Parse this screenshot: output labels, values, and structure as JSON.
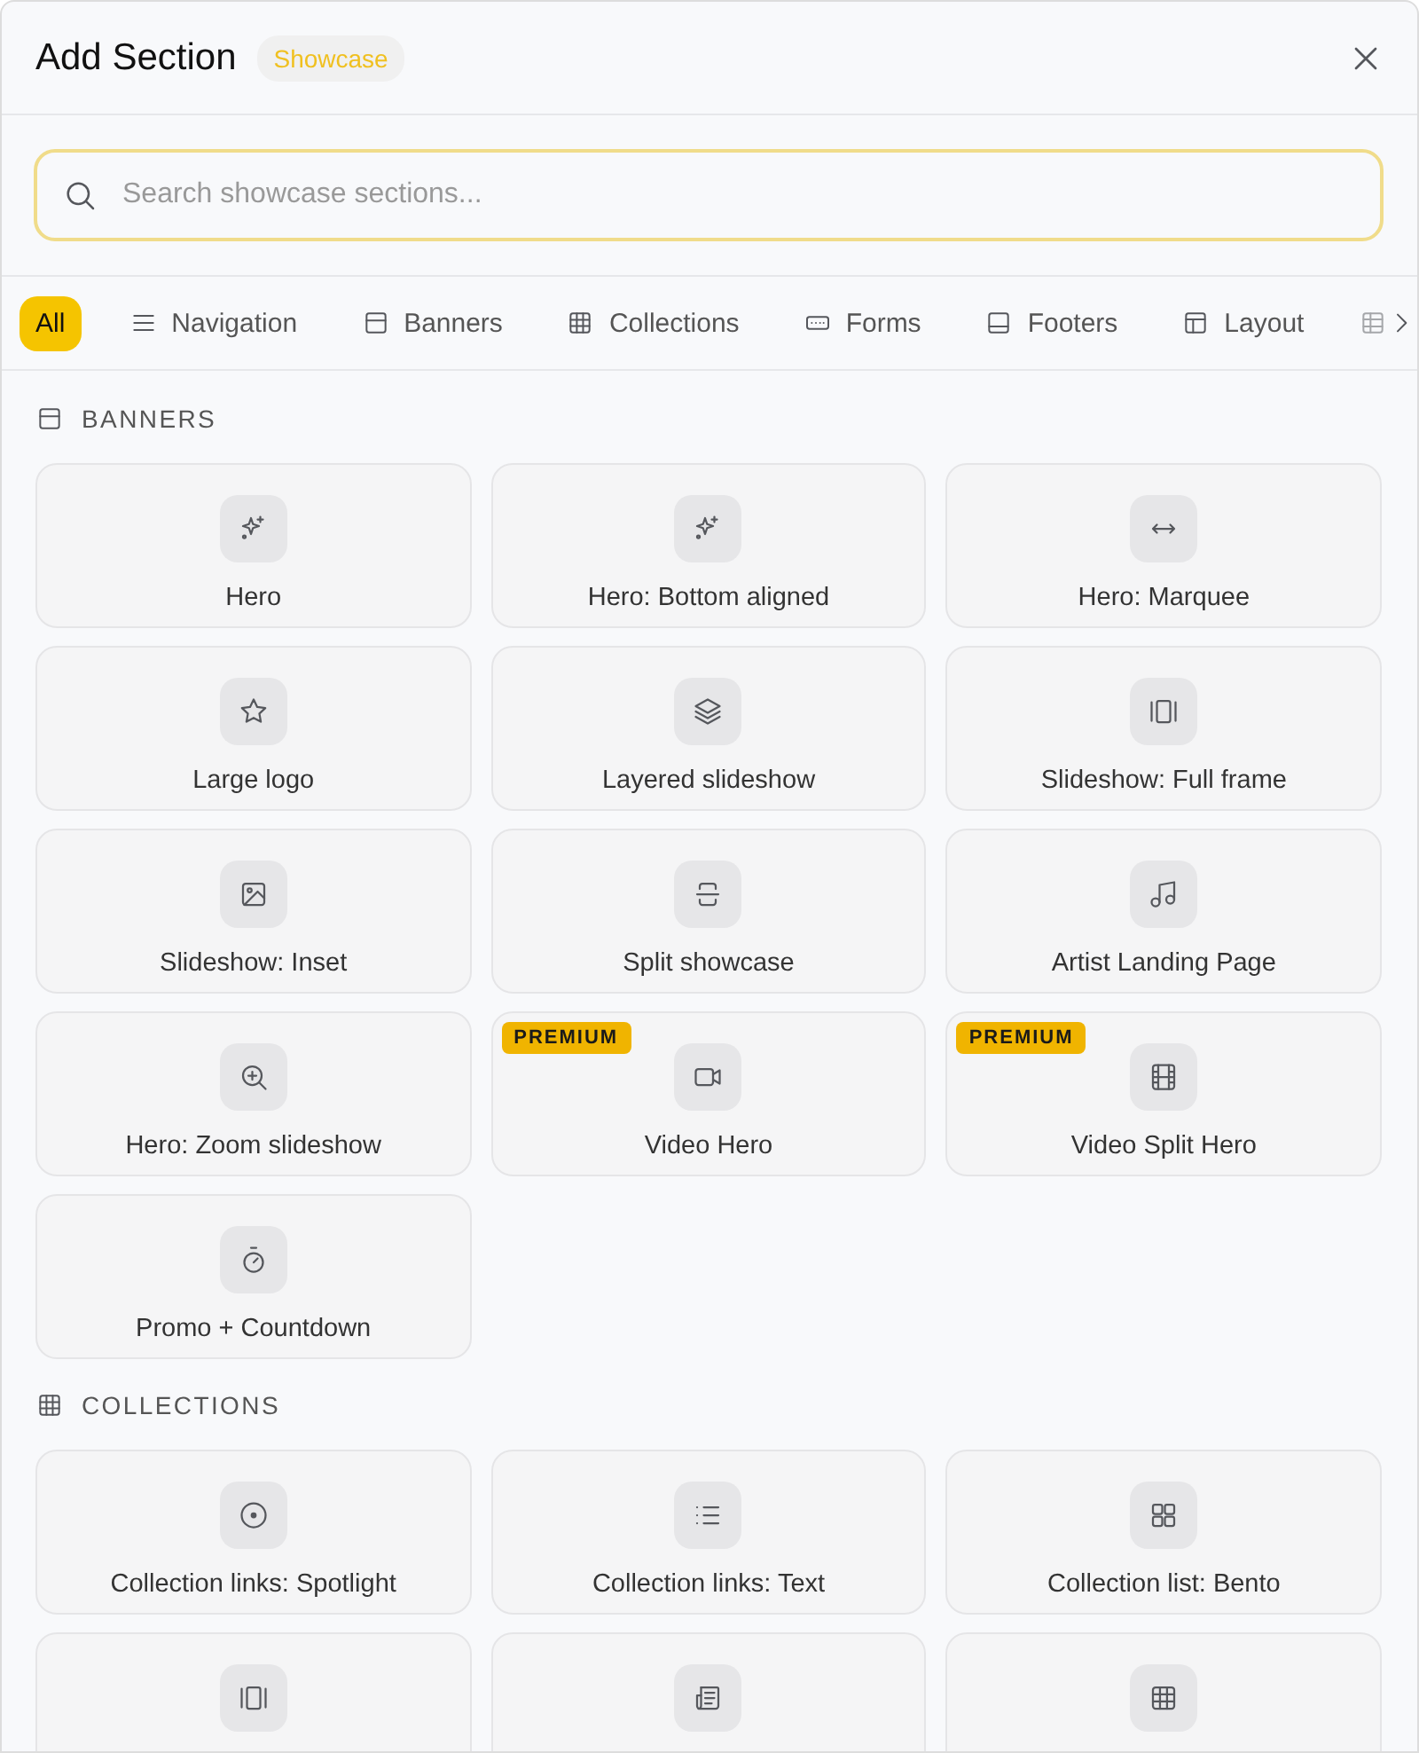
{
  "window": {
    "title": "Add Section",
    "badge": "Showcase"
  },
  "search": {
    "placeholder": "Search showcase sections..."
  },
  "tabs": [
    {
      "label": "All",
      "selected": true
    },
    {
      "label": "Navigation",
      "selected": false
    },
    {
      "label": "Banners",
      "selected": false
    },
    {
      "label": "Collections",
      "selected": false
    },
    {
      "label": "Forms",
      "selected": false
    },
    {
      "label": "Footers",
      "selected": false
    },
    {
      "label": "Layout",
      "selected": false
    }
  ],
  "sections": [
    {
      "title": "BANNERS",
      "items": [
        {
          "kind": "full",
          "label": "Hero"
        },
        {
          "kind": "full",
          "label": "Hero: Bottom aligned"
        },
        {
          "kind": "full",
          "label": "Hero: Marquee"
        },
        {
          "kind": "full",
          "label": "Large logo"
        },
        {
          "kind": "full",
          "label": "Layered slideshow"
        },
        {
          "kind": "full",
          "label": "Slideshow: Full frame"
        },
        {
          "kind": "full",
          "label": "Slideshow: Inset"
        },
        {
          "kind": "full",
          "label": "Split showcase"
        },
        {
          "kind": "full",
          "label": "Artist Landing Page"
        },
        {
          "kind": "full",
          "label": "Hero: Zoom slideshow"
        },
        {
          "kind": "full",
          "label": "Video Hero",
          "badge": "PREMIUM"
        },
        {
          "kind": "full",
          "label": "Video Split Hero",
          "badge": "PREMIUM"
        },
        {
          "kind": "full",
          "label": "Promo + Countdown"
        }
      ]
    },
    {
      "title": "COLLECTIONS",
      "items": [
        {
          "kind": "full",
          "label": "Collection links: Spotlight"
        },
        {
          "kind": "full",
          "label": "Collection links: Text"
        },
        {
          "kind": "full",
          "label": "Collection list: Bento"
        },
        {
          "kind": "cropped"
        },
        {
          "kind": "cropped"
        },
        {
          "kind": "cropped"
        }
      ]
    }
  ]
}
